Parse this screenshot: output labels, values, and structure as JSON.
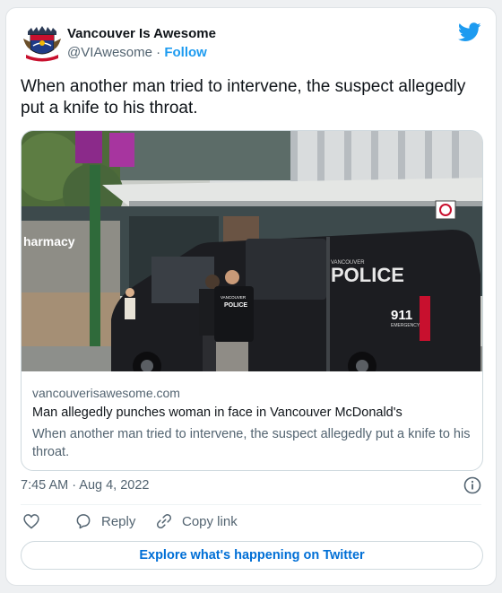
{
  "account": {
    "name": "Vancouver Is Awesome",
    "handle": "@VIAwesome",
    "separator": "·",
    "follow_label": "Follow"
  },
  "tweet": {
    "text": "When another man tried to intervene, the suspect allegedly put a knife to his throat.",
    "timestamp": "7:45 AM · Aug 4, 2022"
  },
  "link_card": {
    "domain": "vancouverisawesome.com",
    "title": "Man allegedly punches woman in face in Vancouver McDonald's",
    "description": "When another man tried to intervene, the suspect allegedly put a knife to his throat.",
    "image": {
      "storefront_sign": "harmacy",
      "van_text": "POLICE",
      "van_small_text": "VANCOUVER",
      "van_number": "911",
      "van_number_sub": "EMERGENCY",
      "vest_text_top": "VANCOUVER",
      "vest_text": "POLICE"
    }
  },
  "actions": {
    "like_label": "",
    "reply_label": "Reply",
    "copy_link_label": "Copy link"
  },
  "explore_label": "Explore what's happening on Twitter",
  "icons": {
    "brand": "twitter-bird-icon",
    "info": "info-icon",
    "like": "heart-icon",
    "reply": "speech-bubble-icon",
    "copy": "link-icon"
  },
  "colors": {
    "brand_blue": "#1d9bf0",
    "link_blue": "#006fd6",
    "secondary_text": "#536471"
  }
}
